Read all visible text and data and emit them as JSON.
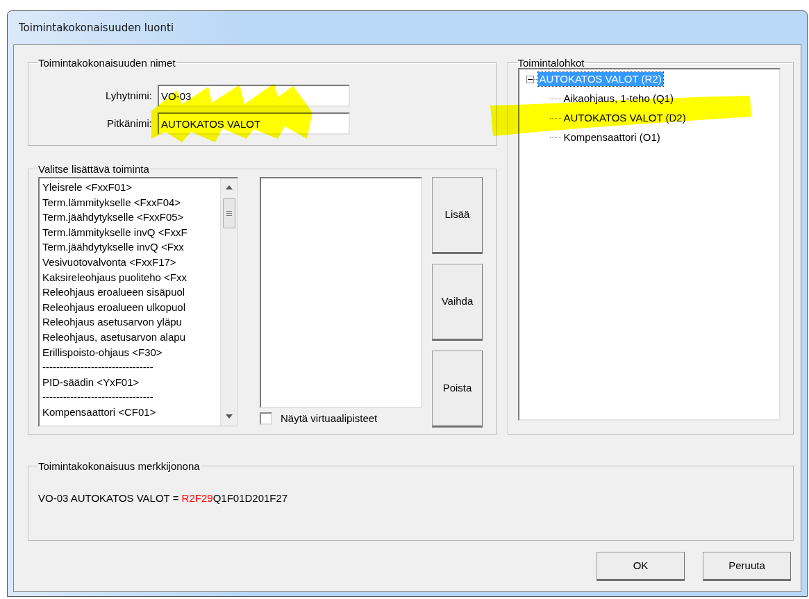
{
  "window": {
    "title": "Toimintakokonaisuuden luonti"
  },
  "names_group": {
    "legend": "Toimintakokonaisuuden nimet",
    "fields": [
      {
        "label": "Lyhytnimi:",
        "value": "VO-03"
      },
      {
        "label": "Pitkänimi:",
        "value": "AUTOKATOS VALOT"
      }
    ]
  },
  "select_group": {
    "legend": "Valitse lisättävä toiminta",
    "available": [
      {
        "text": "Yleisrele <FxxF01>"
      },
      {
        "text": "Term.lämmitykselle <FxxF04>"
      },
      {
        "text": "Term.jäähdytykselle <FxxF05>"
      },
      {
        "text": "Term.lämmitykselle invQ <FxxF"
      },
      {
        "text": "Term.jäähdytykselle invQ <Fxx"
      },
      {
        "text": "Vesivuotovalvonta <FxxF17>"
      },
      {
        "text": "Kaksireleohjaus puoliteho <Fxx"
      },
      {
        "text": "Releohjaus eroalueen sisäpuol"
      },
      {
        "text": "Releohjaus eroalueen ulkopuol"
      },
      {
        "text": "Releohjaus asetusarvon yläpu"
      },
      {
        "text": "Releohjaus, asetusarvon alapu"
      },
      {
        "text": "Erillispoisto-ohjaus <F30>"
      },
      {
        "text": "--------------------------------"
      },
      {
        "text": "PID-säädin <YxF01>"
      },
      {
        "text": "--------------------------------"
      },
      {
        "text": "Kompensaattori <CF01>"
      }
    ],
    "buttons": [
      "Lisää",
      "Vaihda",
      "Poista"
    ],
    "checkbox": {
      "label": "Näytä virtuaalipisteet",
      "checked": false
    }
  },
  "tree_group": {
    "legend": "Toimintalohkot",
    "tree": [
      {
        "label": "AUTOKATOS VALOT  (R2)",
        "selected": true,
        "expanded": true,
        "children": [
          {
            "label": "Aikaohjaus, 1-teho  (Q1)",
            "selected": false
          },
          {
            "label": "AUTOKATOS VALOT  (D2)",
            "selected": false
          },
          {
            "label": "Kompensaattori  (O1)",
            "selected": false
          }
        ]
      }
    ]
  },
  "string_group": {
    "legend": "Toimintakokonaisuus merkkijonona",
    "text": "VO-03 AUTOKATOS VALOT = ",
    "highlight": "R2F29",
    "rest": "Q1F01D201F27"
  },
  "buttons": [
    "OK",
    "Peruuta"
  ]
}
